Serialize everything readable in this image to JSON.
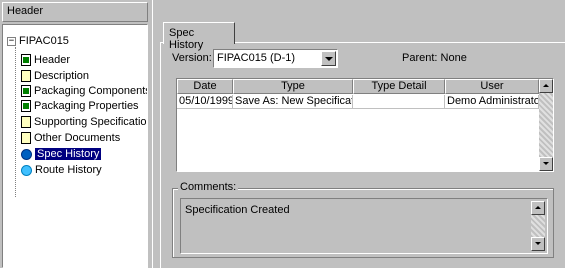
{
  "left_pane": {
    "header_label": "Header",
    "tree": {
      "root": "FIPAC015",
      "items": [
        {
          "label": "Header",
          "icon": "document-filled-icon"
        },
        {
          "label": "Description",
          "icon": "document-icon"
        },
        {
          "label": "Packaging Components",
          "icon": "document-filled-icon"
        },
        {
          "label": "Packaging Properties",
          "icon": "document-filled-icon"
        },
        {
          "label": "Supporting Specifications",
          "icon": "document-icon"
        },
        {
          "label": "Other Documents",
          "icon": "document-icon"
        },
        {
          "label": "Spec History",
          "icon": "globe-icon",
          "selected": true
        },
        {
          "label": "Route History",
          "icon": "drop-icon"
        }
      ]
    }
  },
  "tab": {
    "label": "Spec History"
  },
  "version": {
    "label": "Version:",
    "value": "FIPAC015 (D-1)"
  },
  "parent": {
    "label": "Parent:",
    "value": "None"
  },
  "grid": {
    "columns": [
      "Date",
      "Type",
      "Type Detail",
      "User"
    ],
    "rows": [
      [
        "05/10/1999",
        "Save As: New Specification",
        "",
        "Demo Administrato"
      ]
    ]
  },
  "comments": {
    "label": "Comments:",
    "value": "Specification Created"
  },
  "colors": {
    "selection": "#000080",
    "face": "#c0c0c0"
  }
}
